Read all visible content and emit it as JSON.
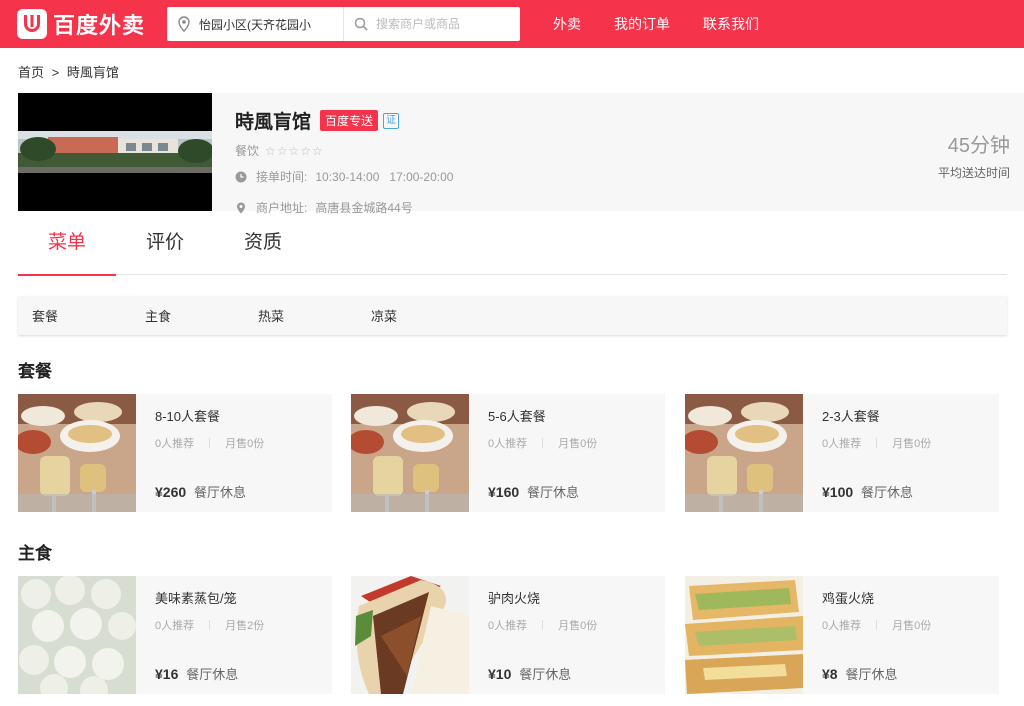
{
  "header": {
    "logo_text": "百度外卖",
    "address": "怡园小区(天齐花园小",
    "search_placeholder": "搜索商户或商品",
    "nav": [
      "外卖",
      "我的订单",
      "联系我们"
    ]
  },
  "breadcrumb": {
    "home": "首页",
    "separator": ">",
    "current": "時風肓馆"
  },
  "shop": {
    "name": "時風肓馆",
    "delivery_tag": "百度专送",
    "cert_tag": "证",
    "category": "餐饮",
    "rating_stars": 0,
    "stars_text": "☆☆☆☆☆",
    "hours_label": "接单时间:",
    "hours_1": "10:30-14:00",
    "hours_2": "17:00-20:00",
    "address_label": "商户地址:",
    "address": "高唐县金城路44号",
    "delivery_time": "45分钟",
    "delivery_time_label": "平均送达时间"
  },
  "tabs": [
    "菜单",
    "评价",
    "资质"
  ],
  "active_tab": 0,
  "categories": [
    "套餐",
    "主食",
    "热菜",
    "凉菜"
  ],
  "sections": [
    {
      "title": "套餐",
      "items": [
        {
          "name": "8-10人套餐",
          "recommend": "0人推荐",
          "sold": "月售0份",
          "price": "¥260",
          "status": "餐厅休息"
        },
        {
          "name": "5-6人套餐",
          "recommend": "0人推荐",
          "sold": "月售0份",
          "price": "¥160",
          "status": "餐厅休息"
        },
        {
          "name": "2-3人套餐",
          "recommend": "0人推荐",
          "sold": "月售0份",
          "price": "¥100",
          "status": "餐厅休息"
        }
      ]
    },
    {
      "title": "主食",
      "items": [
        {
          "name": "美味素蒸包/笼",
          "recommend": "0人推荐",
          "sold": "月售2份",
          "price": "¥16",
          "status": "餐厅休息"
        },
        {
          "name": "驴肉火烧",
          "recommend": "0人推荐",
          "sold": "月售0份",
          "price": "¥10",
          "status": "餐厅休息"
        },
        {
          "name": "鸡蛋火烧",
          "recommend": "0人推荐",
          "sold": "月售0份",
          "price": "¥8",
          "status": "餐厅休息"
        }
      ]
    }
  ],
  "colors": {
    "brand": "#f5334b",
    "panel": "#f7f7f7"
  }
}
